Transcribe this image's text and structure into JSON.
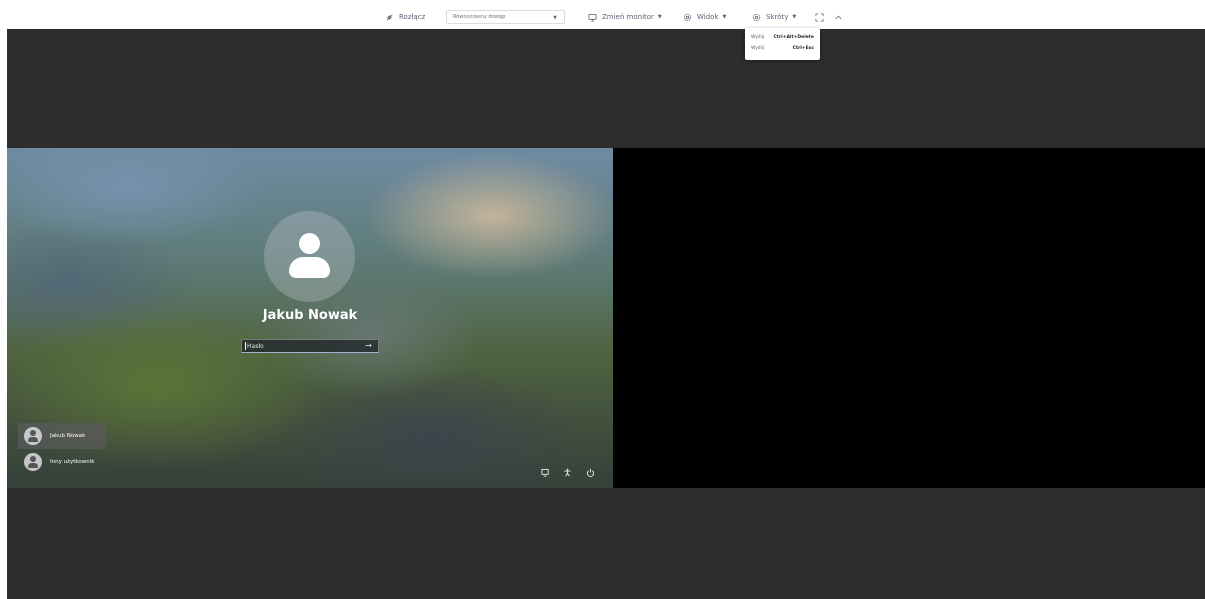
{
  "toolbar": {
    "disconnect_label": "Rozłącz",
    "access_mode": "Równoczesny dostęp",
    "switch_monitor_label": "Zmień monitor",
    "view_label": "Widok",
    "shortcuts_label": "Skróty"
  },
  "shortcuts_menu": {
    "items": [
      {
        "label": "Wyślij",
        "keys": "Ctrl+Alt+Delete"
      },
      {
        "label": "Wyślij",
        "keys": "Ctrl+Esc"
      }
    ]
  },
  "login_screen": {
    "user_name": "Jakub Nowak",
    "password_placeholder": "Hasło",
    "arrow": "→",
    "users": [
      {
        "name": "Jakub Nowak"
      },
      {
        "name": "Inny użytkownik"
      }
    ]
  },
  "colors": {
    "remote_background": "#2d2d2d",
    "secondary_monitor": "#000000",
    "toolbar_text": "#5b6475"
  }
}
